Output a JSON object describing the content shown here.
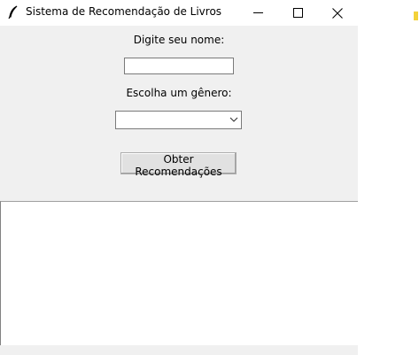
{
  "window": {
    "title": "Sistema de Recomendação de Livros"
  },
  "form": {
    "name_label": "Digite seu nome:",
    "name_value": "",
    "genre_label": "Escolha um gênero:",
    "genre_selected": "",
    "button_label": "Obter Recomendações"
  },
  "output": {
    "text": ""
  },
  "icons": {
    "app": "feather-icon",
    "minimize": "minimize-icon",
    "maximize": "maximize-icon",
    "close": "close-icon",
    "dropdown": "chevron-down-icon"
  },
  "colors": {
    "window_bg": "#f0f0f0",
    "titlebar_bg": "#ffffff",
    "button_bg": "#e1e1e1",
    "border": "#7a7a7a"
  }
}
